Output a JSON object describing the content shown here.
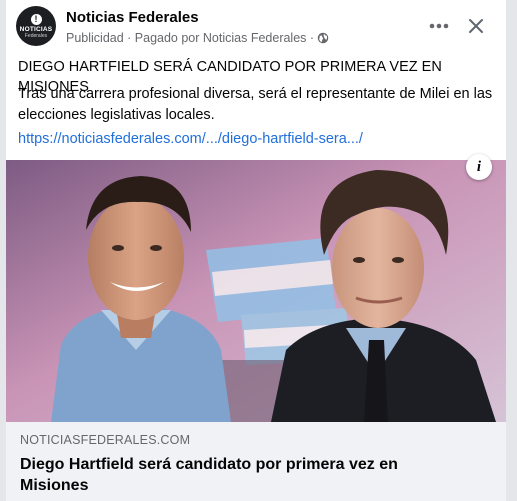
{
  "post": {
    "page_name": "Noticias Federales",
    "meta_text": "Publicidad · Pagado por Noticias Federales ·",
    "avatar": {
      "line1": "NOTICIAS",
      "line2": "Federales",
      "mark": "!"
    },
    "headline": "DIEGO HARTFIELD SERÁ CANDIDATO POR PRIMERA VEZ EN MISIONES",
    "body": "Tras una carrera profesional diversa, será el representante de Milei en las elecciones legislativas locales.",
    "link_text": "https://noticiasfederales.com/.../diego-hartfield-sera.../"
  },
  "link_preview": {
    "domain": "NOTICIASFEDERALES.COM",
    "title": "Diego Hartfield será candidato por primera vez en Misiones"
  },
  "icons": {
    "globe": "globe-icon",
    "more": "more-options-icon",
    "close": "close-icon",
    "info": "info-icon"
  },
  "colors": {
    "link": "#216fdb",
    "secondary_text": "#65676b",
    "footer_bg": "#f0f2f5"
  }
}
